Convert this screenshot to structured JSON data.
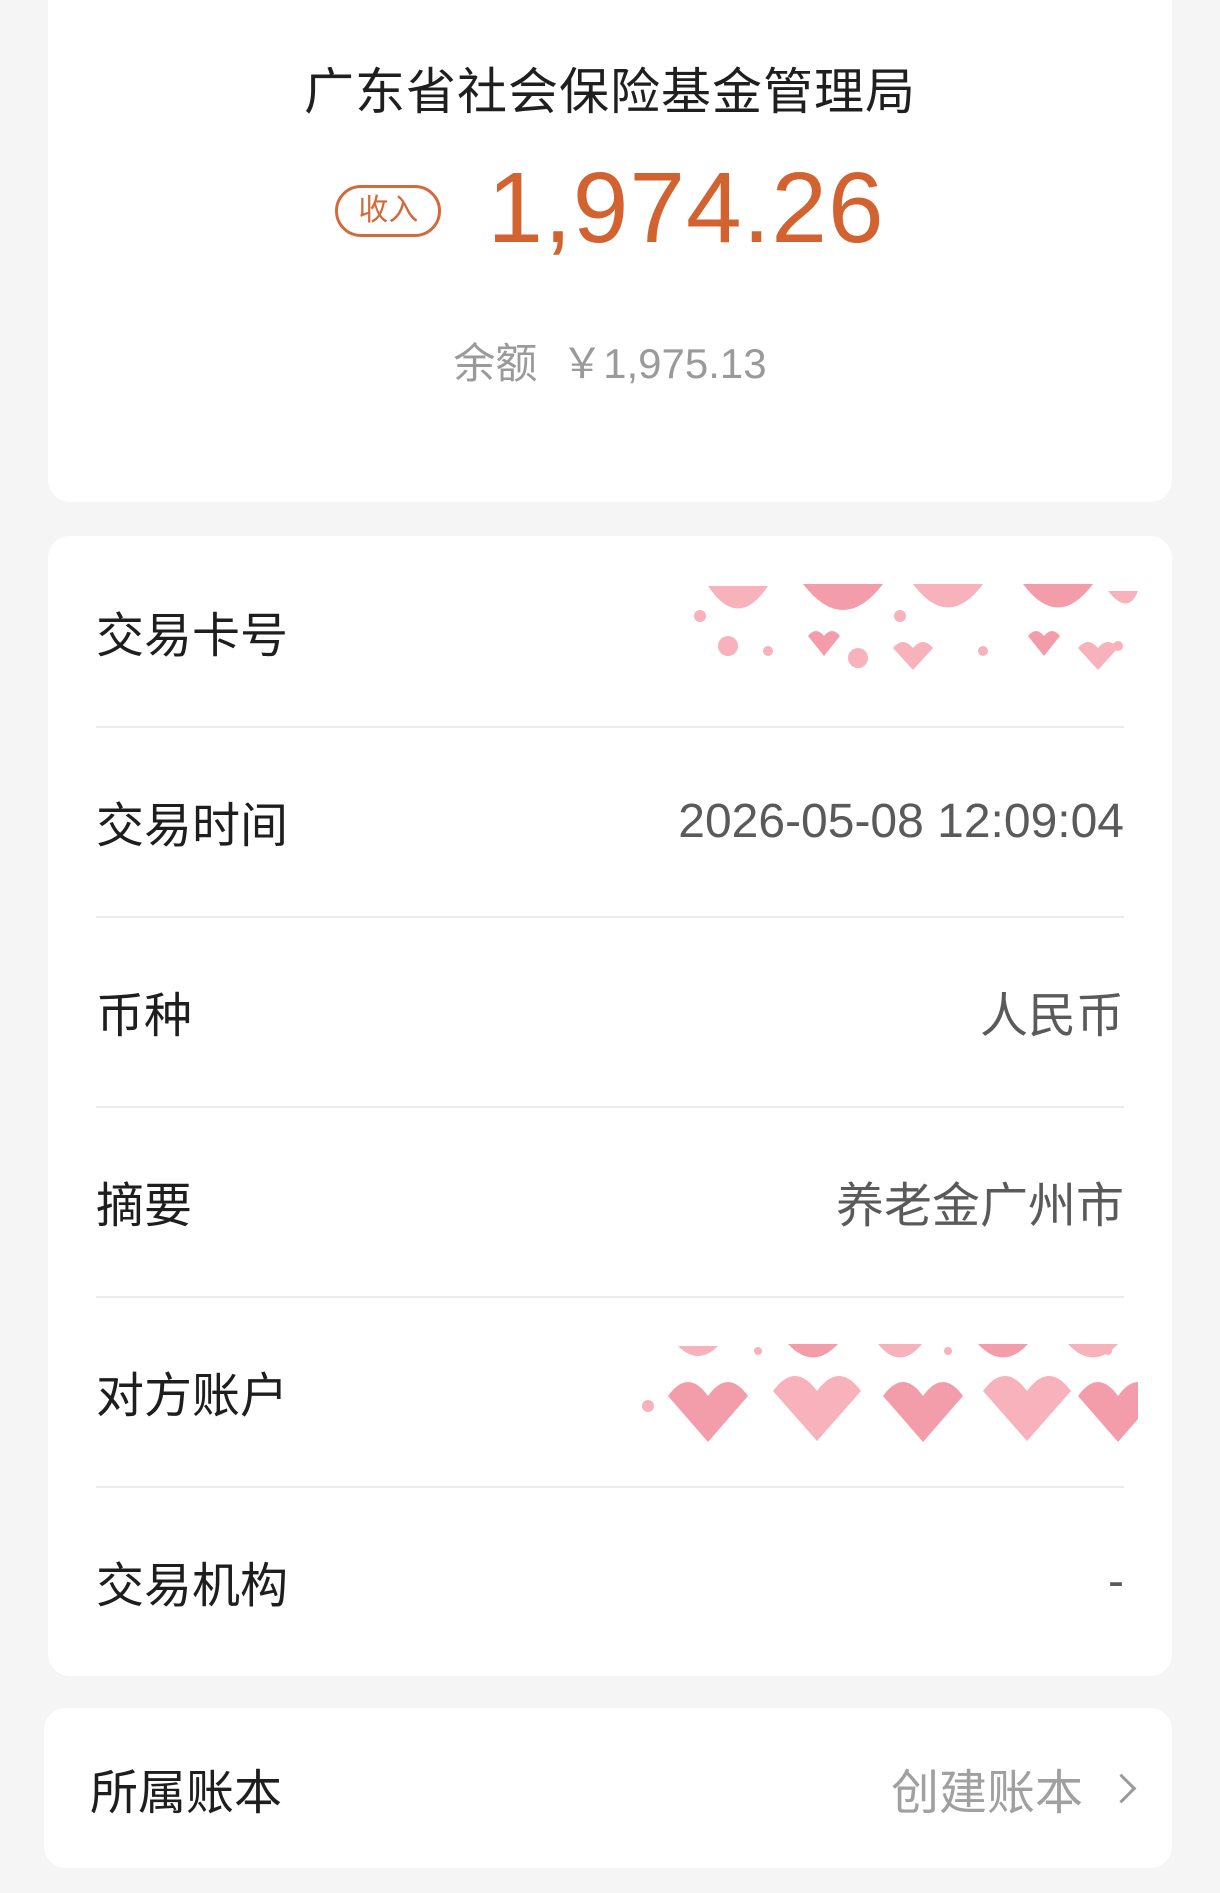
{
  "summary": {
    "merchant": "广东省社会保险基金管理局",
    "type_badge": "收入",
    "amount": "1,974.26",
    "balance_label": "余额",
    "balance_value": "￥1,975.13"
  },
  "details": {
    "rows": [
      {
        "label": "交易卡号",
        "value": "",
        "masked": true
      },
      {
        "label": "交易时间",
        "value": "2026-05-08 12:09:04"
      },
      {
        "label": "币种",
        "value": "人民币"
      },
      {
        "label": "摘要",
        "value": "养老金广州市"
      },
      {
        "label": "对方账户",
        "value": "",
        "masked": true
      },
      {
        "label": "交易机构",
        "value": "-"
      }
    ]
  },
  "ledger": {
    "label": "所属账本",
    "action": "创建账本"
  },
  "colors": {
    "accent": "#d2622f",
    "background": "#f5f5f5",
    "mask_pink": "#f6a5b0"
  },
  "icons": {
    "chevron": "chevron-right-icon",
    "mask": "heart-sticker-icon"
  }
}
